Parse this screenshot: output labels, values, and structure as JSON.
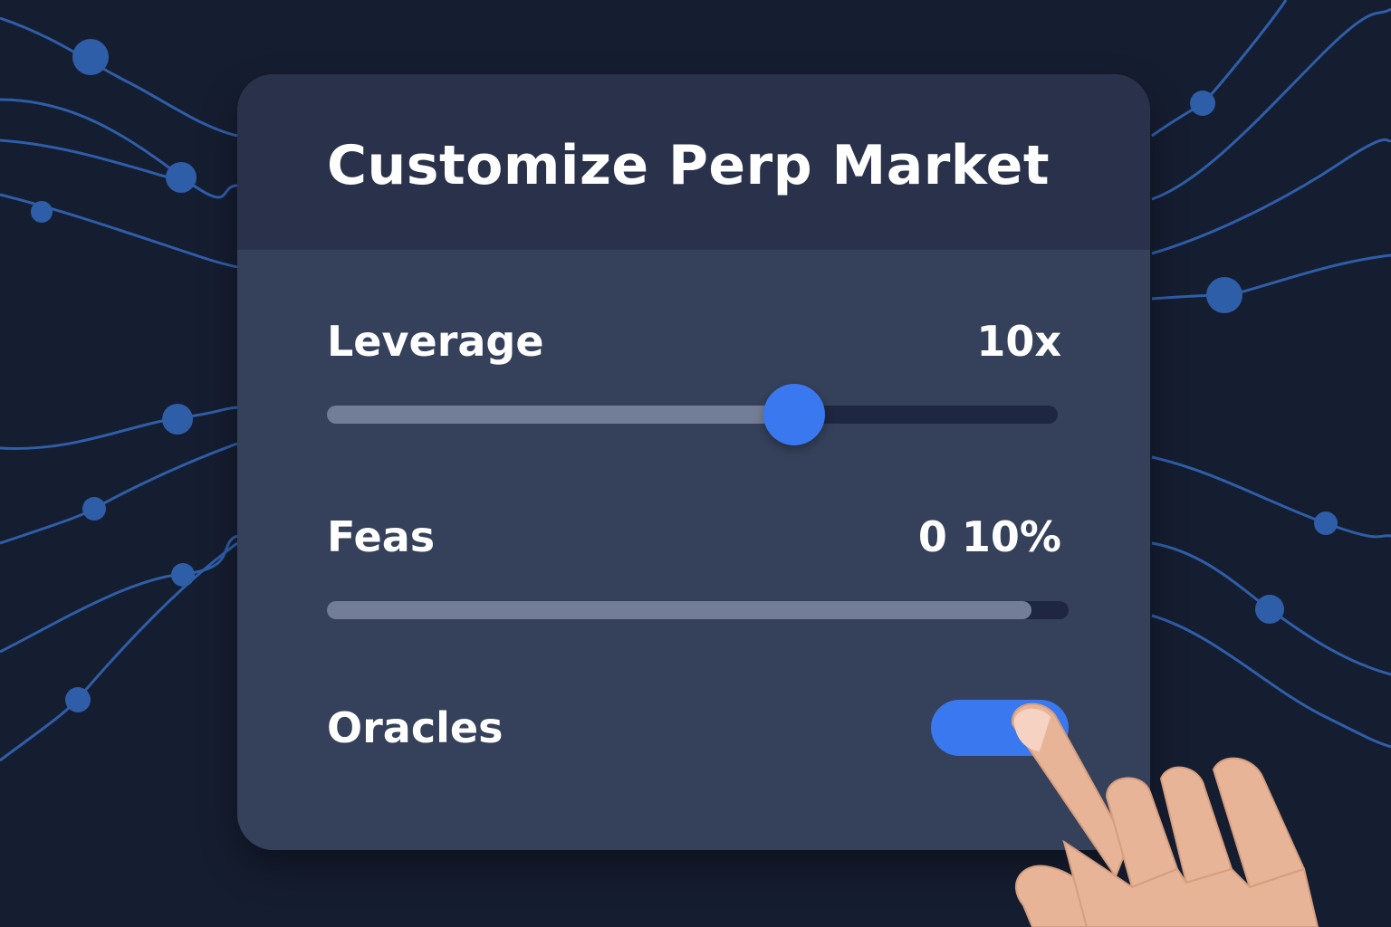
{
  "panel": {
    "title": "Customize Perp Market"
  },
  "leverage": {
    "label": "Leverage",
    "value_text": "10x",
    "slider_fraction": 0.64
  },
  "fees": {
    "label": "Feas",
    "value_text": "0 10%",
    "bar_fraction": 0.95
  },
  "oracles": {
    "label": "Oracles",
    "toggle_on": true
  },
  "colors": {
    "background": "#151d30",
    "panel": "#35405a",
    "header": "#2a314b",
    "accent": "#3a78ef",
    "track": "#1f2740",
    "fill": "#737e96",
    "network_line": "#2f5ea8",
    "skin": "#e8b497"
  }
}
